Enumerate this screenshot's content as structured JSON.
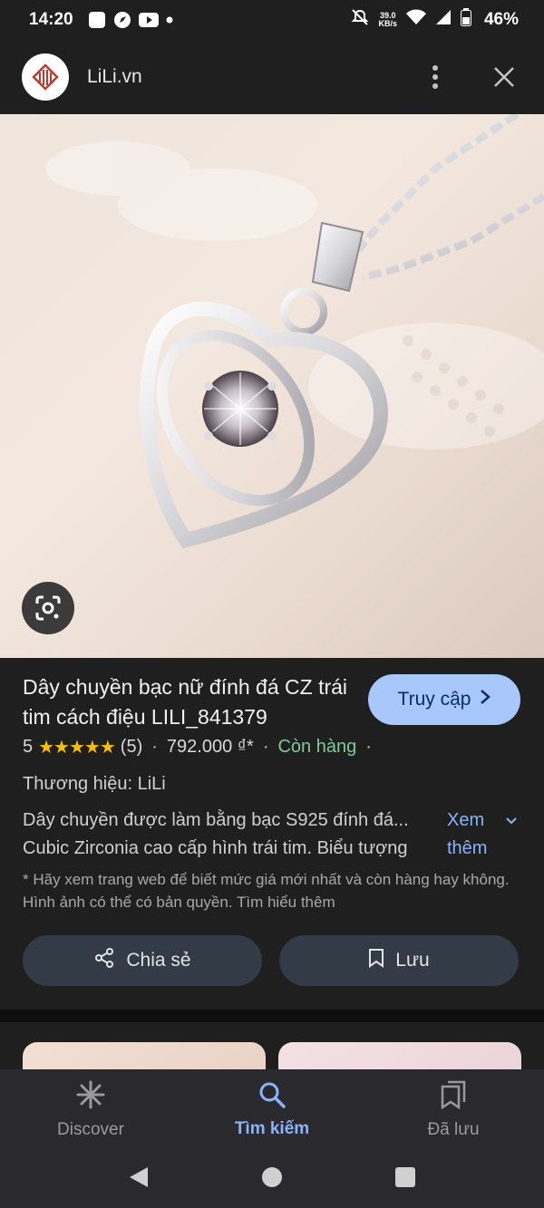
{
  "status_bar": {
    "time": "14:20",
    "net_speed_value": "39.0",
    "net_speed_unit": "KB/s",
    "battery": "46%"
  },
  "header": {
    "site_name": "LiLi.vn",
    "logo_icon": "lili-logo",
    "more_icon": "more-vertical-icon",
    "close_icon": "close-icon"
  },
  "image": {
    "lens_icon": "google-lens-icon"
  },
  "product": {
    "title": "Dây chuyền bạc nữ đính đá CZ trái tim cách điệu LILI_841379",
    "visit_label": "Truy cập",
    "rating": "5",
    "stars": "★★★★★",
    "review_count": "(5)",
    "price": "792.000 ₫*",
    "availability": "Còn hàng",
    "brand": "Thương hiệu: LiLi",
    "description_line1": "Dây chuyền được làm bằng bạc S925 đính đá...",
    "description_line2": "Cubic Zirconia cao cấp hình trái tim. Biểu tượng",
    "see_more_line1": "Xem",
    "see_more_line2": "thêm",
    "note": "* Hãy xem trang web để biết mức giá mới nhất và còn hàng hay không. Hình ảnh có thể có bản quyền. Tìm hiểu thêm",
    "share_label": "Chia sẻ",
    "save_label": "Lưu"
  },
  "bottom_nav": {
    "items": [
      {
        "label": "Discover",
        "icon": "asterisk-icon",
        "active": false
      },
      {
        "label": "Tìm kiếm",
        "icon": "search-icon",
        "active": true
      },
      {
        "label": "Đã lưu",
        "icon": "saved-icon",
        "active": false
      }
    ]
  },
  "colors": {
    "background": "#1f1f1f",
    "accent": "#a8c7fa",
    "link": "#8ab4f8",
    "in_stock": "#81c995",
    "star": "#fbbc04"
  }
}
